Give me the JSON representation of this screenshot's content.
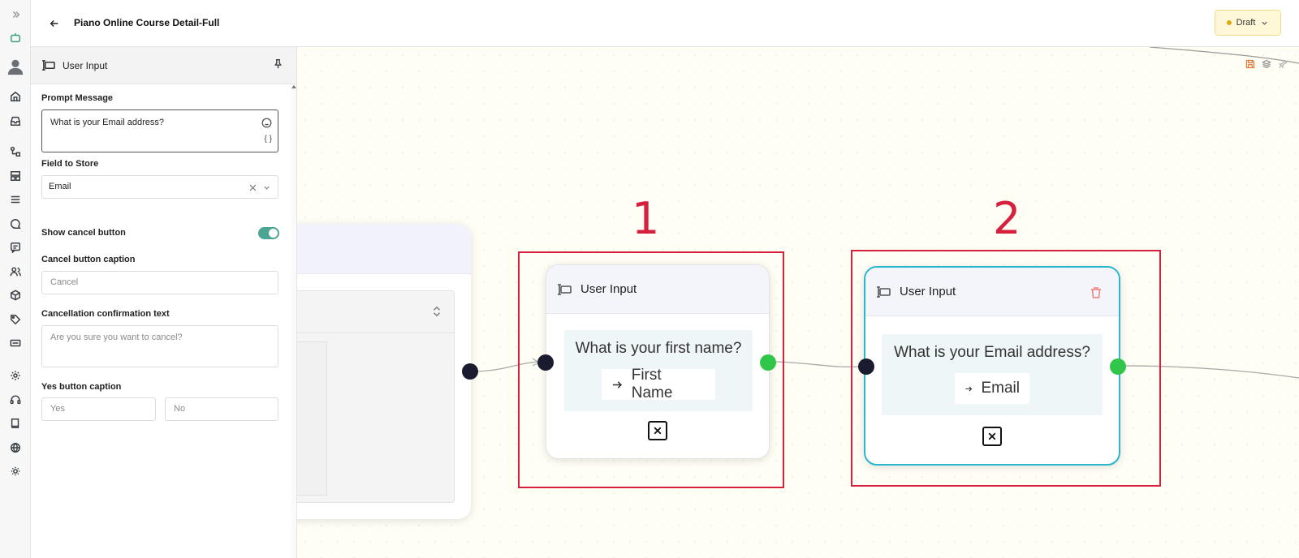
{
  "header": {
    "title": "Piano Online Course Detail-Full",
    "status_label": "Draft",
    "status_color": "#e2a812"
  },
  "rail": {
    "icons": [
      "expand-icon",
      "bot-icon",
      "avatar",
      "home-icon",
      "inbox-icon",
      "flow-icon",
      "layout-icon",
      "list-icon",
      "chat-icon",
      "message-icon",
      "users-icon",
      "cube-icon",
      "tag-icon",
      "ticket-icon",
      "settings-icon",
      "headset-icon",
      "book-icon",
      "globe-icon",
      "theme-icon"
    ]
  },
  "panel": {
    "title": "User Input",
    "prompt_label": "Prompt Message",
    "prompt_value": "What is your Email address?",
    "variable_token": "{ }",
    "field_label": "Field to Store",
    "field_value": "Email",
    "show_cancel_label": "Show cancel button",
    "show_cancel_enabled": true,
    "cancel_caption_label": "Cancel button caption",
    "cancel_caption_placeholder": "Cancel",
    "confirm_text_label": "Cancellation confirmation text",
    "confirm_text_placeholder": "Are you sure you want to cancel?",
    "yes_caption_label": "Yes button caption",
    "yes_placeholder": "Yes",
    "no_placeholder": "No"
  },
  "nodes": [
    {
      "title": "User Input",
      "question": "What is your first name?",
      "field": "First Name"
    },
    {
      "title": "User Input",
      "question": "What is your Email address?",
      "field": "Email"
    }
  ],
  "annotations": [
    "1",
    "2"
  ],
  "colors": {
    "accent_teal": "#4aa593",
    "selected_border": "#29b6cf",
    "annotation_red": "#d6203e",
    "port_green": "#2fc64a",
    "port_dark": "#1a1b2e",
    "canvas_bg": "#fffef4"
  }
}
